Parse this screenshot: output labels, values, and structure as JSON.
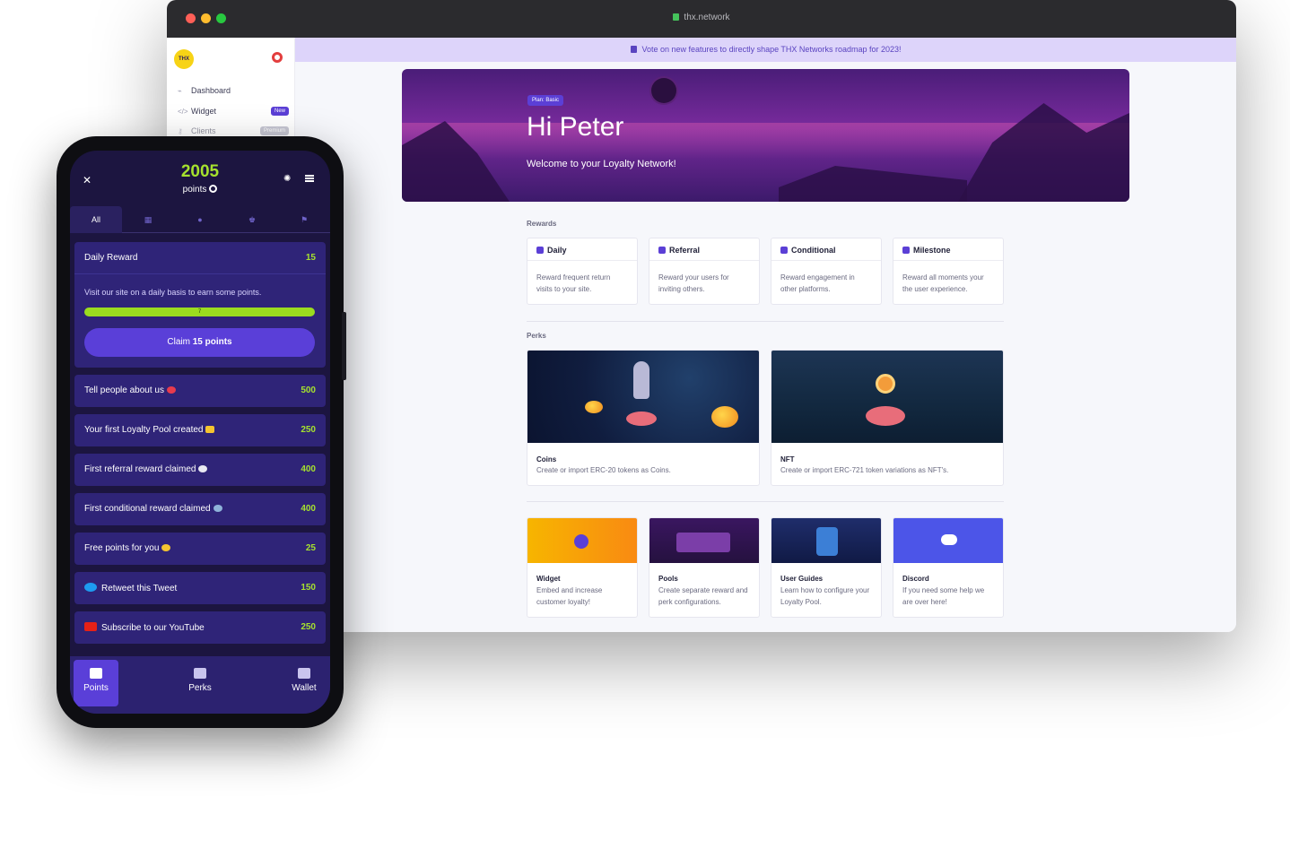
{
  "browser": {
    "url": "thx.network"
  },
  "sidebar": {
    "logo": "THX",
    "items": [
      {
        "label": "Dashboard",
        "icon": "chart-icon"
      },
      {
        "label": "Widget",
        "icon": "code-icon",
        "badge": "New"
      },
      {
        "label": "Clients",
        "icon": "key-icon",
        "badge": "Premium"
      }
    ]
  },
  "announcement": {
    "text": "Vote on new features to directly shape THX Networks roadmap for 2023!"
  },
  "hero": {
    "plan": "Plan: Basic",
    "title": "Hi Peter",
    "subtitle": "Welcome to your Loyalty Network!"
  },
  "rewards": {
    "heading": "Rewards",
    "cards": [
      {
        "title": "Daily",
        "desc": "Reward frequent return visits to your site."
      },
      {
        "title": "Referral",
        "desc": "Reward your users for inviting others."
      },
      {
        "title": "Conditional",
        "desc": "Reward engagement in other platforms."
      },
      {
        "title": "Milestone",
        "desc": "Reward all moments your the user experience."
      }
    ]
  },
  "perks": {
    "heading": "Perks",
    "cards": [
      {
        "title": "Coins",
        "desc": "Create or import ERC-20 tokens as Coins."
      },
      {
        "title": "NFT",
        "desc": "Create or import ERC-721 token variations as NFT's."
      }
    ]
  },
  "resources": [
    {
      "title": "Widget",
      "desc": "Embed and increase customer loyalty!"
    },
    {
      "title": "Pools",
      "desc": "Create separate reward and perk configurations."
    },
    {
      "title": "User Guides",
      "desc": "Learn how to configure your Loyalty Pool."
    },
    {
      "title": "Discord",
      "desc": "If you need some help we are over here!"
    }
  ],
  "phone": {
    "points": "2005",
    "points_label": "points",
    "tabs": [
      "All"
    ],
    "tab_icons": [
      "calendar-icon",
      "chat-icon",
      "trophy-icon",
      "flag-icon"
    ],
    "daily": {
      "title": "Daily Reward",
      "points": "15",
      "desc": "Visit our site on a daily basis to earn some points.",
      "progress_label": "7",
      "progress_fraction": 1.0,
      "claim_prefix": "Claim ",
      "claim_points": "15 points"
    },
    "items": [
      {
        "title": "Tell people about us",
        "points": "500"
      },
      {
        "title": "Your first Loyalty Pool created",
        "points": "250"
      },
      {
        "title": "First referral reward claimed",
        "points": "400"
      },
      {
        "title": "First conditional reward claimed",
        "points": "400"
      },
      {
        "title": "Free points for you",
        "points": "25"
      },
      {
        "title": "Retweet this Tweet",
        "points": "150"
      },
      {
        "title": "Subscribe to our YouTube",
        "points": "250"
      }
    ],
    "footer": [
      "Points",
      "Perks",
      "Wallet"
    ]
  },
  "colors": {
    "accent": "#5a3fd8",
    "points_green": "#a6e22e",
    "phone_bg": "#1c1540"
  }
}
